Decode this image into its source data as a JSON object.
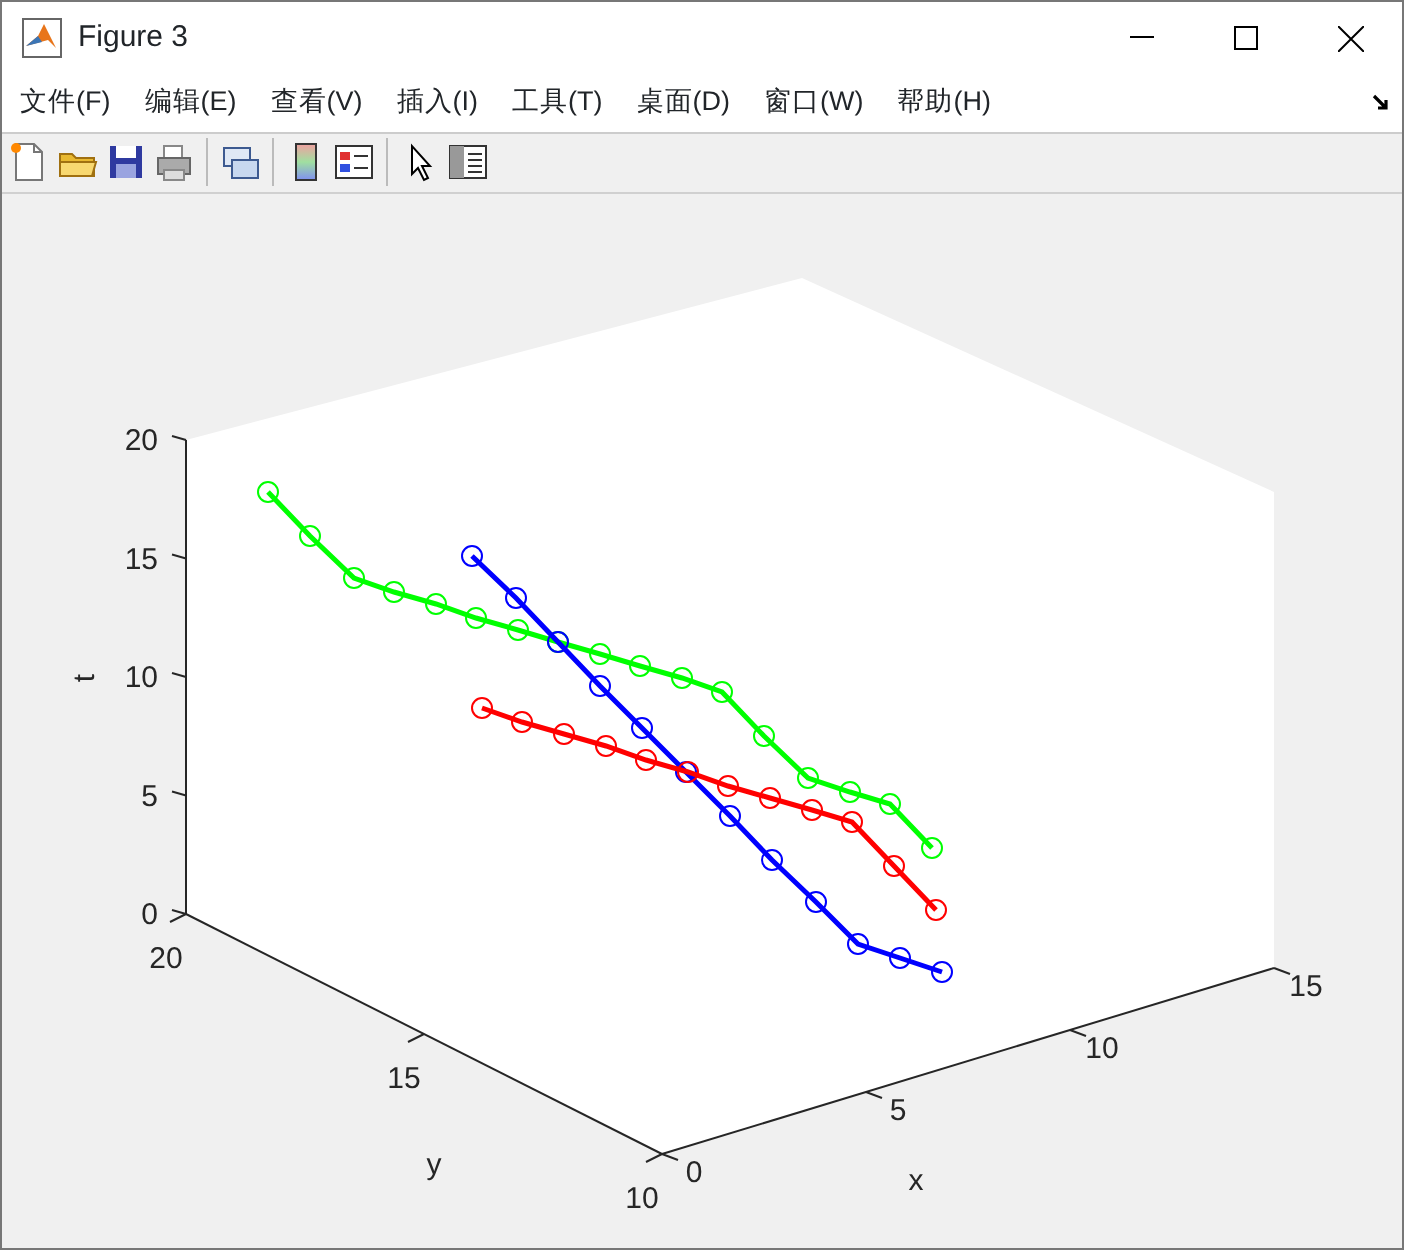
{
  "window": {
    "title": "Figure 3"
  },
  "menu": [
    {
      "label": "文件(F)"
    },
    {
      "label": "编辑(E)"
    },
    {
      "label": "查看(V)"
    },
    {
      "label": "插入(I)"
    },
    {
      "label": "工具(T)"
    },
    {
      "label": "桌面(D)"
    },
    {
      "label": "窗口(W)"
    },
    {
      "label": "帮助(H)"
    }
  ],
  "toolbar": [
    {
      "kind": "new"
    },
    {
      "kind": "open"
    },
    {
      "kind": "save"
    },
    {
      "kind": "print"
    },
    {
      "kind": "separator"
    },
    {
      "kind": "link"
    },
    {
      "kind": "separator"
    },
    {
      "kind": "colorbar"
    },
    {
      "kind": "legend"
    },
    {
      "kind": "separator"
    },
    {
      "kind": "pointer"
    },
    {
      "kind": "panel"
    }
  ],
  "plot": {
    "zlabel": "t",
    "ylabel": "y",
    "xlabel": "x",
    "zticks": [
      "20",
      "15",
      "10",
      "5",
      "0"
    ],
    "yticks": [
      "20",
      "15",
      "10"
    ],
    "xticks": [
      "0",
      "5",
      "10",
      "15"
    ],
    "series": [
      {
        "color": "#00ff00"
      },
      {
        "color": "#0000ff"
      },
      {
        "color": "#ff0000"
      }
    ]
  }
}
